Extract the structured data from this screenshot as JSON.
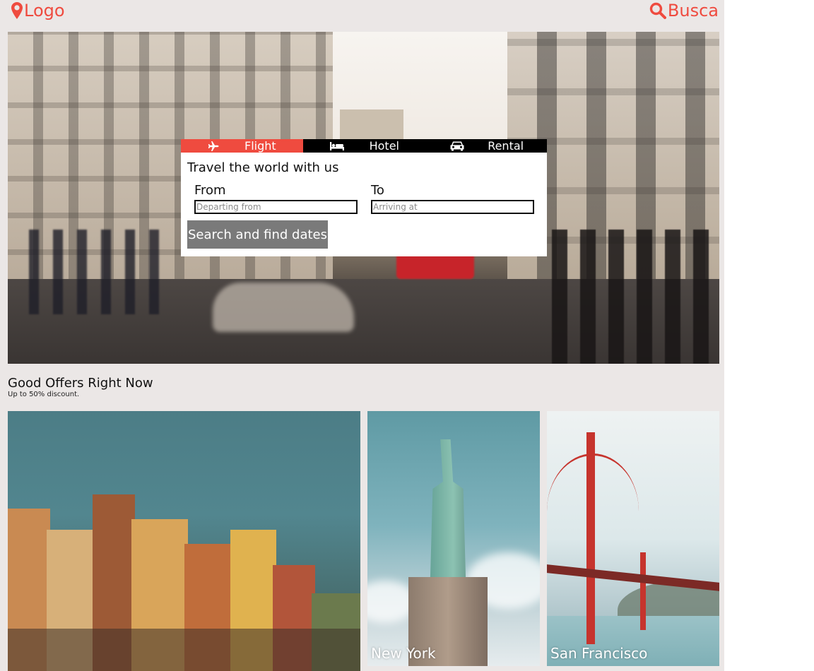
{
  "header": {
    "logo_label": "Logo",
    "search_label": "Busca",
    "logo_icon": "map-marker-icon",
    "search_icon": "magnifier-icon",
    "accent_color": "#ef4b3f"
  },
  "booking": {
    "tabs": [
      {
        "label": "Flight",
        "icon": "plane-icon",
        "active": true
      },
      {
        "label": "Hotel",
        "icon": "bed-icon",
        "active": false
      },
      {
        "label": "Rental",
        "icon": "car-icon",
        "active": false
      }
    ],
    "title": "Travel the world with us",
    "from": {
      "label": "From",
      "placeholder": "Departing from",
      "value": ""
    },
    "to": {
      "label": "To",
      "placeholder": "Arriving at",
      "value": ""
    },
    "submit_label": "Search and find dates"
  },
  "offers": {
    "title": "Good Offers Right Now",
    "subtitle": "Up to 50% discount.",
    "cards": [
      {
        "caption": ""
      },
      {
        "caption": "New York"
      },
      {
        "caption": "San Francisco"
      }
    ]
  }
}
